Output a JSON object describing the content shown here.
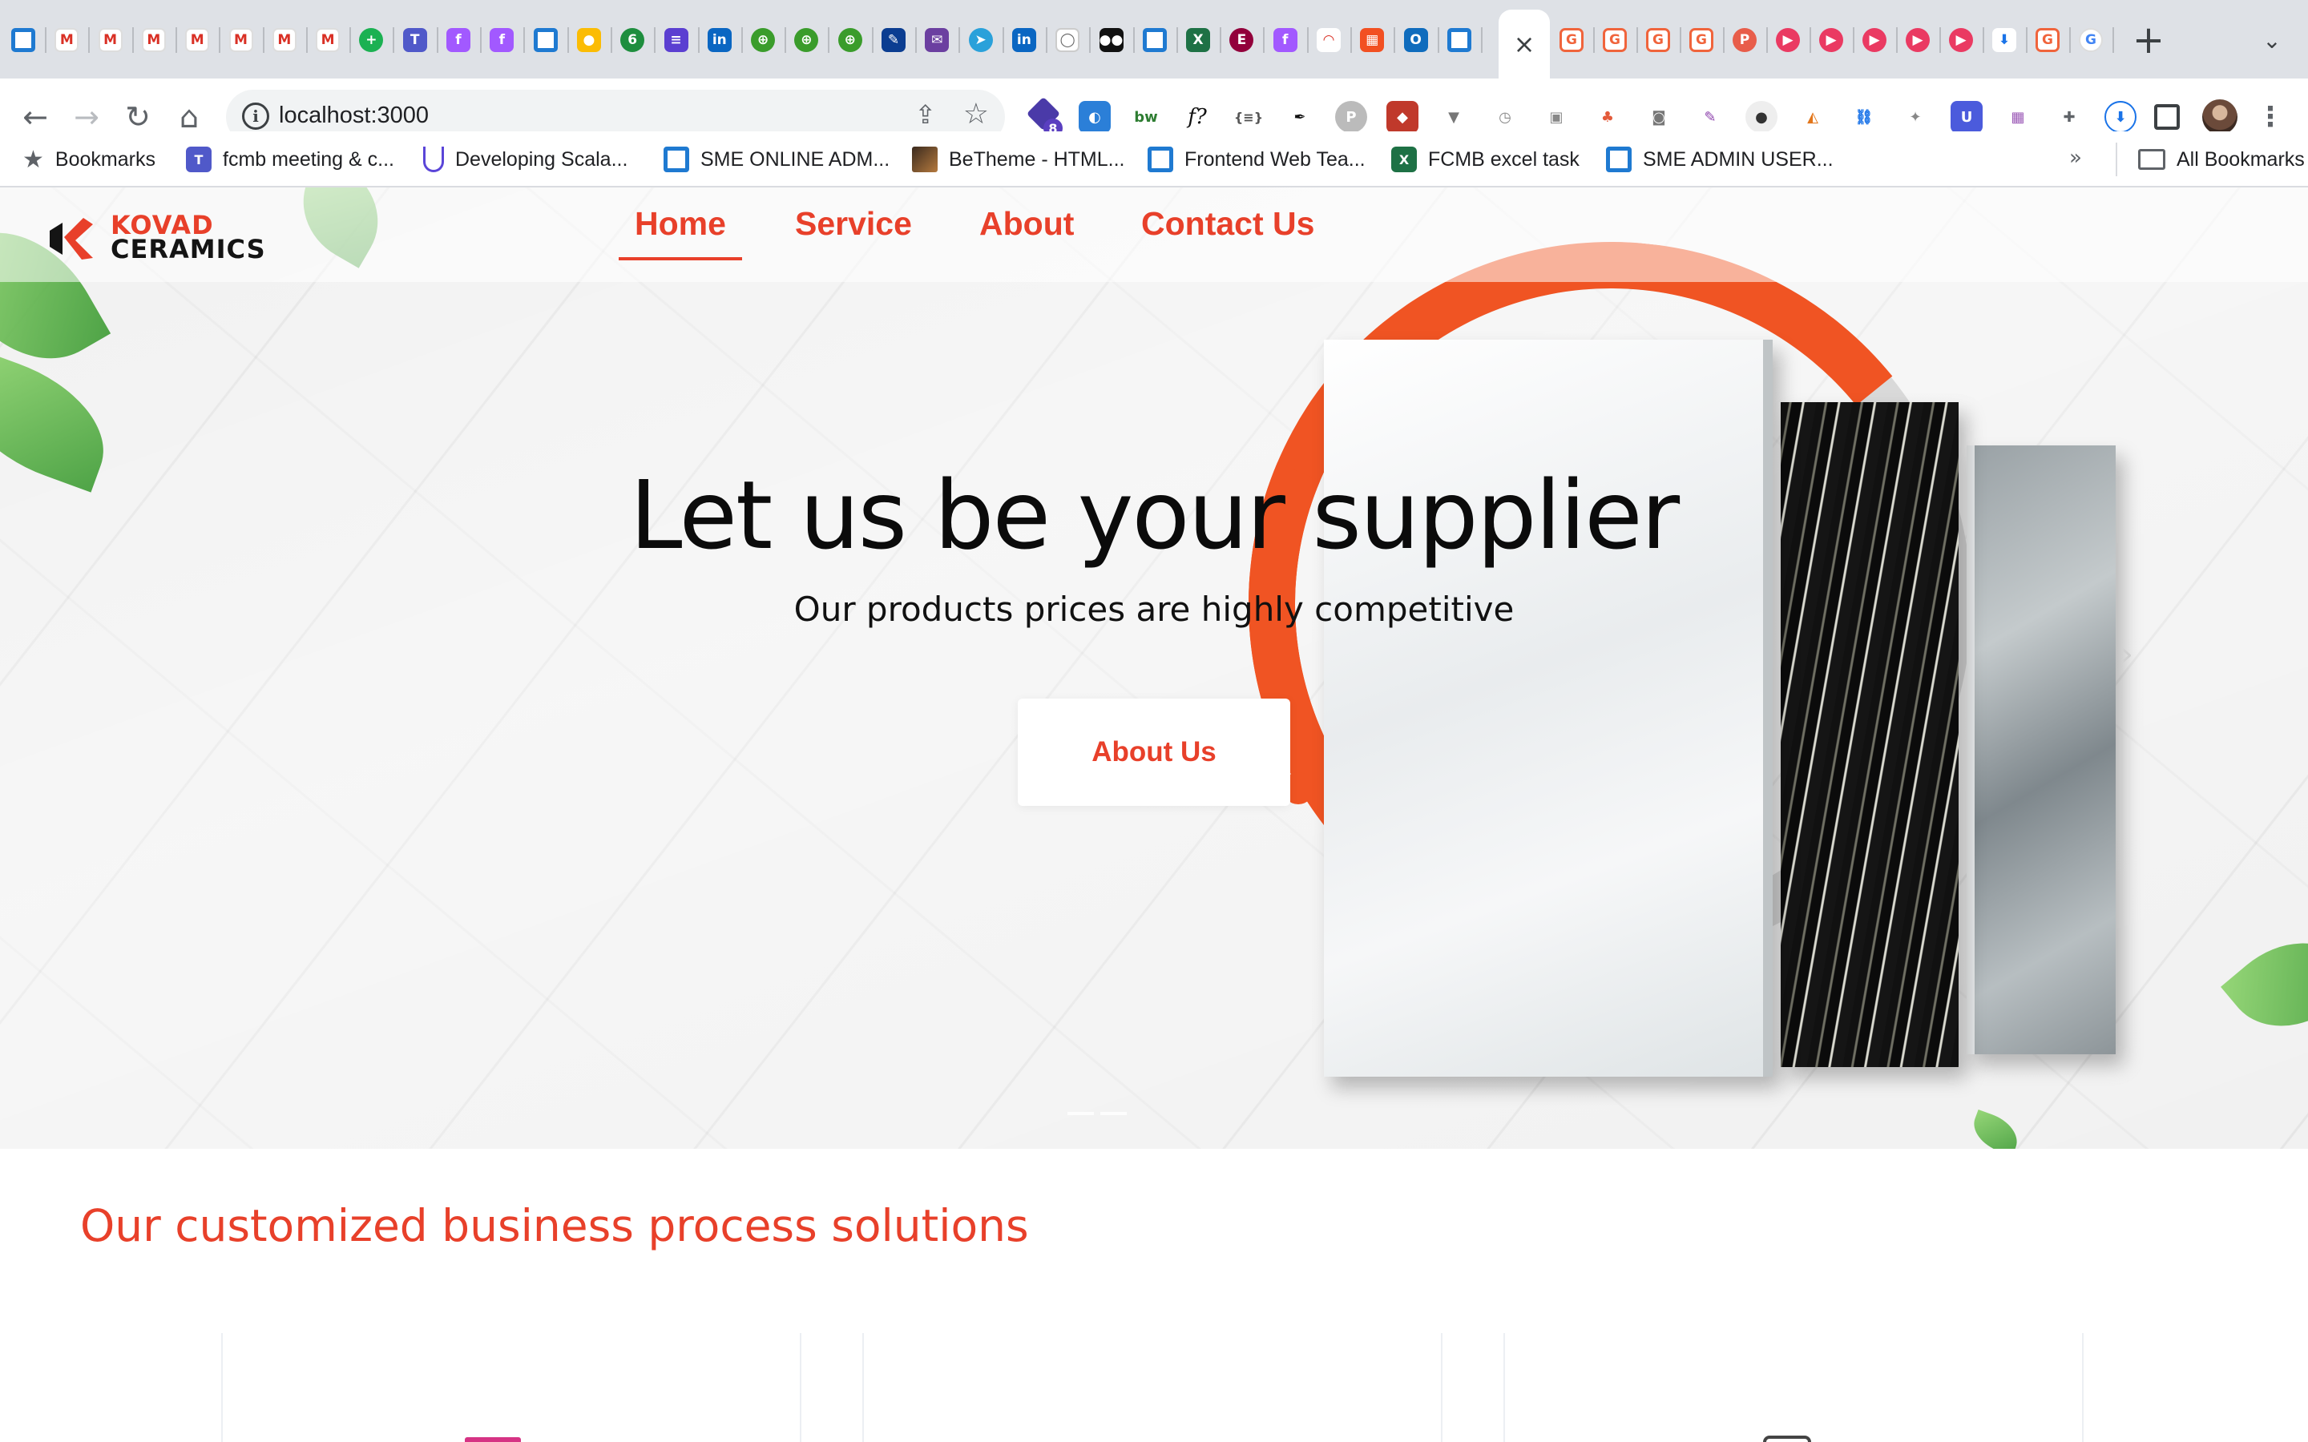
{
  "browser": {
    "address": "localhost:3000",
    "tab_favicons": [
      "azure-devops",
      "gmail",
      "gmail",
      "gmail",
      "gmail",
      "gmail",
      "gmail",
      "gmail",
      "green-plus",
      "teams",
      "figma",
      "figma",
      "azure-devops",
      "keep",
      "green-6",
      "list",
      "linkedin",
      "green-globe",
      "green-globe",
      "green-globe",
      "pen",
      "mail",
      "telegram",
      "linkedin",
      "github",
      "medium",
      "azure-devops",
      "excel",
      "elementor",
      "figma",
      "speedometer",
      "microsoft",
      "outlook",
      "azure-devops"
    ],
    "tabs_after_active": [
      "gitlab",
      "gitlab",
      "gitlab",
      "gitlab",
      "pinterest",
      "play",
      "play",
      "play",
      "play",
      "play",
      "download",
      "gitlab",
      "google"
    ],
    "active_tab_close": "×",
    "new_tab": "+",
    "extensions": [
      "badge-8",
      "edge",
      "bw",
      "f?",
      "json",
      "pen-tool",
      "p",
      "red-ext",
      "v",
      "clock",
      "gallery",
      "people",
      "camera",
      "feather",
      "location",
      "metamask",
      "link",
      "puzzle-grey",
      "u",
      "table",
      "puzzle",
      "download"
    ],
    "extension_badge": "8"
  },
  "bookmarks": {
    "items": [
      {
        "label": "Bookmarks",
        "icon": "star-icon"
      },
      {
        "label": "fcmb meeting & c...",
        "icon": "teams-icon"
      },
      {
        "label": "Developing Scala...",
        "icon": "udemy-icon"
      },
      {
        "label": "SME ONLINE ADM...",
        "icon": "azure-devops-icon"
      },
      {
        "label": "BeTheme - HTML...",
        "icon": "betheme-icon"
      },
      {
        "label": "Frontend Web Tea...",
        "icon": "azure-devops-icon"
      },
      {
        "label": "FCMB excel task",
        "icon": "excel-icon"
      },
      {
        "label": "SME ADMIN USER...",
        "icon": "azure-devops-icon"
      }
    ],
    "overflow": "»",
    "all_label": "All Bookmarks"
  },
  "site": {
    "logo_line1": "KOVAD",
    "logo_line2": "CERAMICS",
    "nav": [
      "Home",
      "Service",
      "About",
      "Contact Us"
    ],
    "active_nav": "Home",
    "hero_title": "Let us be your supplier",
    "hero_subtitle": "Our products prices are highly competitive",
    "hero_button": "About Us",
    "section_title": "Our customized business process solutions"
  },
  "colors": {
    "accent": "#e8402a",
    "arc_orange": "#f05423",
    "chrome_bg": "#dee1e6"
  }
}
